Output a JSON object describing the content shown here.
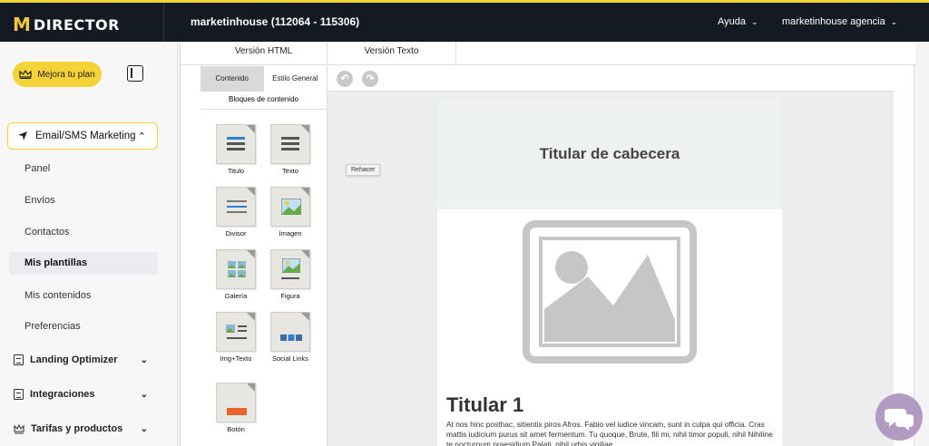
{
  "topbar": {
    "brand_mark": "M",
    "brand_name": "DIRECTOR",
    "account": "marketinhouse (112064 - 115306)",
    "help": "Ayuda",
    "user": "marketinhouse agencia",
    "accent": "#f3d33a"
  },
  "sidebar": {
    "upgrade": "Mejora tu plan",
    "section": "Email/SMS Marketing",
    "items": [
      "Panel",
      "Envíos",
      "Contactos",
      "Mis plantillas",
      "Mis contenidos",
      "Preferencias"
    ],
    "selected_index": 3,
    "groups": [
      "Landing Optimizer",
      "Integraciones",
      "Tarifas y productos"
    ]
  },
  "editor": {
    "tabs": [
      "Versión HTML",
      "Versión Texto"
    ],
    "palette_tabs": [
      "Contenido",
      "Estilo General"
    ],
    "palette_header": "Bloques de contenido",
    "blocks": [
      "Titulo",
      "Texto",
      "Divisor",
      "Imagen",
      "Galería",
      "Figura",
      "Img+Texto",
      "Social Links",
      "Botón"
    ],
    "tooltip": "Rehacer"
  },
  "email": {
    "header": "Titular de cabecera",
    "h1": "Titular 1",
    "body": "At nos hinc posthac, sitientis piros Afros. Fabio vel iudice vincam, sunt in culpa qui officia. Cras mattis iudicium purus sit amet fermentum. Tu quoque, Brute, fili mi, nihil timor populi, nihil Nihiline te nocturnum praesidium Palati, nihil urbis vigiliae."
  },
  "icons": [
    "crown-icon",
    "sidebar-toggle-icon",
    "send-icon",
    "undo-icon",
    "redo-icon",
    "chat-icon"
  ]
}
